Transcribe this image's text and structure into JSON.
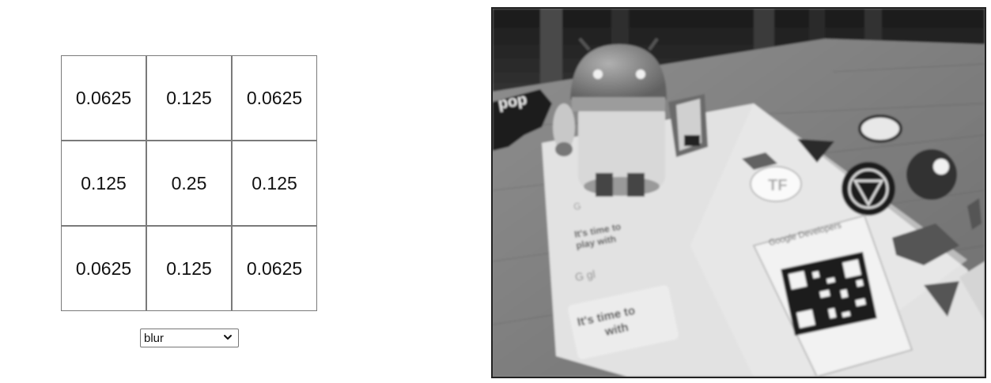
{
  "kernel": {
    "rows": [
      [
        "0.0625",
        "0.125",
        "0.0625"
      ],
      [
        "0.125",
        "0.25",
        "0.125"
      ],
      [
        "0.0625",
        "0.125",
        "0.0625"
      ]
    ]
  },
  "filter_select": {
    "selected": "blur"
  },
  "photo": {
    "description_icon": "grayscale-photo",
    "sticker_texts": {
      "line1": "It's time to",
      "line2": "play with",
      "line3": "It's time to",
      "line4": "with",
      "brand": "Google Developers"
    }
  }
}
